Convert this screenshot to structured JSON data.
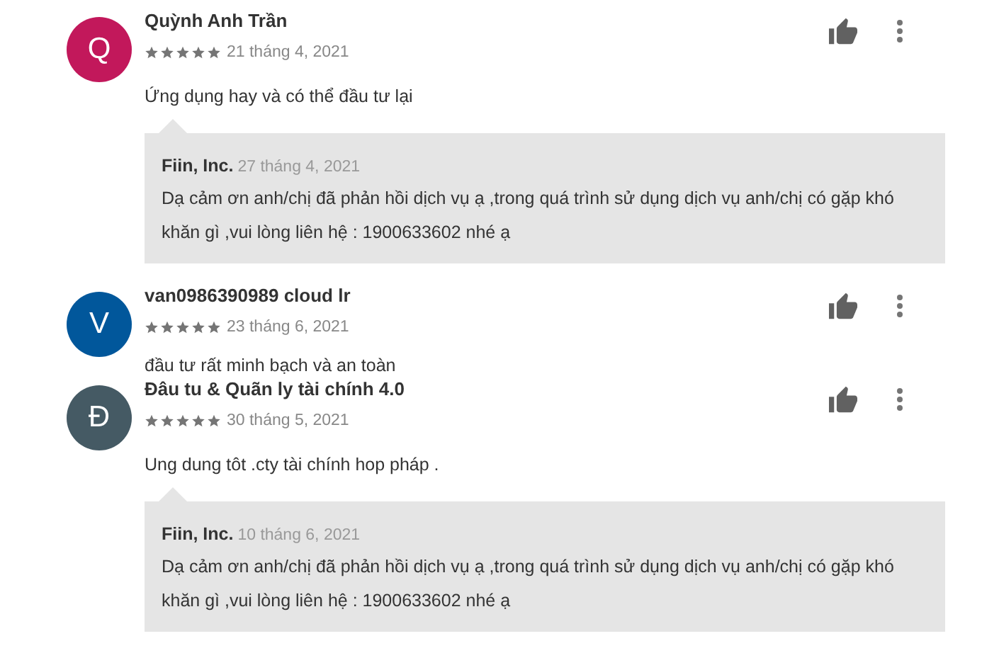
{
  "reviews": [
    {
      "initial": "Q",
      "color": "#c2185b",
      "author": "Quỳnh Anh Trần",
      "stars": 5,
      "date": "21 tháng 4, 2021",
      "text": "Ứng dụng hay và có thể đầu tư lại",
      "reply": {
        "author": "Fiin, Inc.",
        "date": "27 tháng 4, 2021",
        "text": "Dạ cảm ơn anh/chị đã phản hồi dịch vụ ạ ,trong quá trình sử dụng dịch vụ anh/chị có gặp khó khăn gì ,vui lòng liên hệ : 1900633602 nhé ạ"
      }
    },
    {
      "initial": "V",
      "color": "#01579b",
      "author": "van0986390989 cloud lr",
      "stars": 5,
      "date": "23 tháng 6, 2021",
      "text": "đầu tư rất minh bạch và an toàn"
    },
    {
      "initial": "Đ",
      "color": "#455a64",
      "author": "Đâu tu & Quãn ly tài chính 4.0",
      "stars": 5,
      "date": "30 tháng 5, 2021",
      "text": "Ung dung tôt .cty tài chính hop pháp .",
      "reply": {
        "author": "Fiin, Inc.",
        "date": "10 tháng 6, 2021",
        "text": "Dạ cảm ơn anh/chị đã phản hồi dịch vụ ạ ,trong quá trình sử dụng dịch vụ anh/chị có gặp khó khăn gì ,vui lòng liên hệ : 1900633602 nhé ạ"
      }
    }
  ]
}
